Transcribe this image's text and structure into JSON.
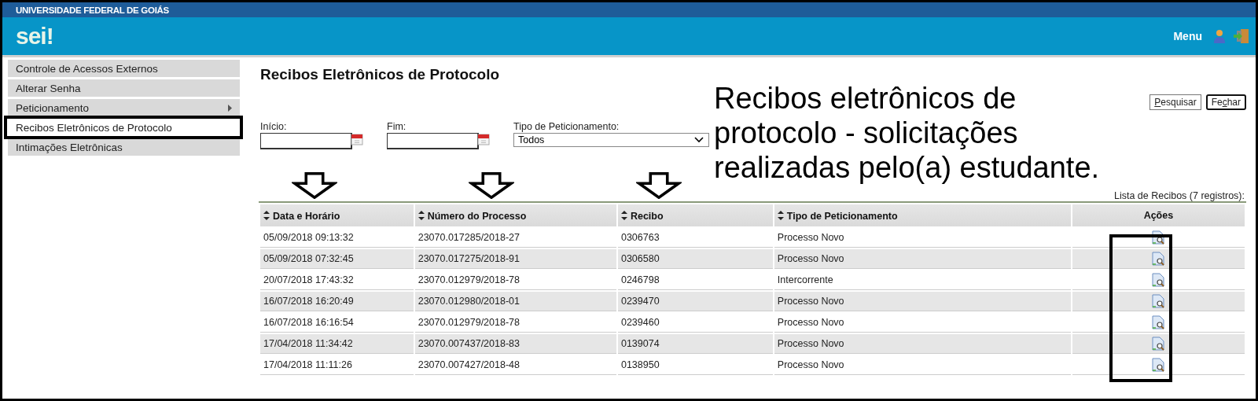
{
  "header": {
    "institution": "UNIVERSIDADE FEDERAL DE GOIÁS",
    "logo": "sei!",
    "menu_label": "Menu"
  },
  "sidebar": {
    "items": [
      {
        "label": "Controle de Acessos Externos",
        "selected": false,
        "submenu": false
      },
      {
        "label": "Alterar Senha",
        "selected": false,
        "submenu": false
      },
      {
        "label": "Peticionamento",
        "selected": false,
        "submenu": true
      },
      {
        "label": "Recibos Eletrônicos de Protocolo",
        "selected": true,
        "submenu": false
      },
      {
        "label": "Intimações Eletrônicas",
        "selected": false,
        "submenu": false
      }
    ]
  },
  "page": {
    "title": "Recibos Eletrônicos de Protocolo",
    "buttons": [
      {
        "default": false,
        "parts": [
          {
            "text": "P",
            "underlined": true
          },
          {
            "text": "esquisar",
            "underlined": false
          }
        ]
      },
      {
        "default": true,
        "parts": [
          {
            "text": "Fe",
            "underlined": false
          },
          {
            "text": "c",
            "underlined": true
          },
          {
            "text": "har",
            "underlined": false
          }
        ]
      }
    ],
    "filters": [
      {
        "kind": "date",
        "label": "Início:"
      },
      {
        "kind": "date",
        "label": "Fim:"
      },
      {
        "kind": "select",
        "label": "Tipo de Peticionamento:",
        "value": "Todos"
      }
    ]
  },
  "table": {
    "caption": "Lista de Recibos (7 registros):",
    "columns": [
      {
        "label": "Data e Horário",
        "sortable": true
      },
      {
        "label": "Número do Processo",
        "sortable": true
      },
      {
        "label": "Recibo",
        "sortable": true
      },
      {
        "label": "Tipo de Peticionamento",
        "sortable": true
      },
      {
        "label": "Ações",
        "sortable": false
      }
    ],
    "rows": [
      {
        "cells": [
          "05/09/2018 09:13:32",
          "23070.017285/2018-27",
          "0306763",
          "Processo Novo"
        ]
      },
      {
        "cells": [
          "05/09/2018 07:32:45",
          "23070.017275/2018-91",
          "0306580",
          "Processo Novo"
        ]
      },
      {
        "cells": [
          "20/07/2018 17:43:32",
          "23070.012979/2018-78",
          "0246798",
          "Intercorrente"
        ]
      },
      {
        "cells": [
          "16/07/2018 16:20:49",
          "23070.012980/2018-01",
          "0239470",
          "Processo Novo"
        ]
      },
      {
        "cells": [
          "16/07/2018 16:16:54",
          "23070.012979/2018-78",
          "0239460",
          "Processo Novo"
        ]
      },
      {
        "cells": [
          "17/04/2018 11:34:42",
          "23070.007437/2018-83",
          "0139074",
          "Processo Novo"
        ]
      },
      {
        "cells": [
          "17/04/2018 11:11:26",
          "23070.007427/2018-48",
          "0138950",
          "Processo Novo"
        ]
      }
    ]
  },
  "annotation": {
    "text": "Recibos eletrônicos de protocolo - solicitações realizadas pelo(a) estudante."
  }
}
